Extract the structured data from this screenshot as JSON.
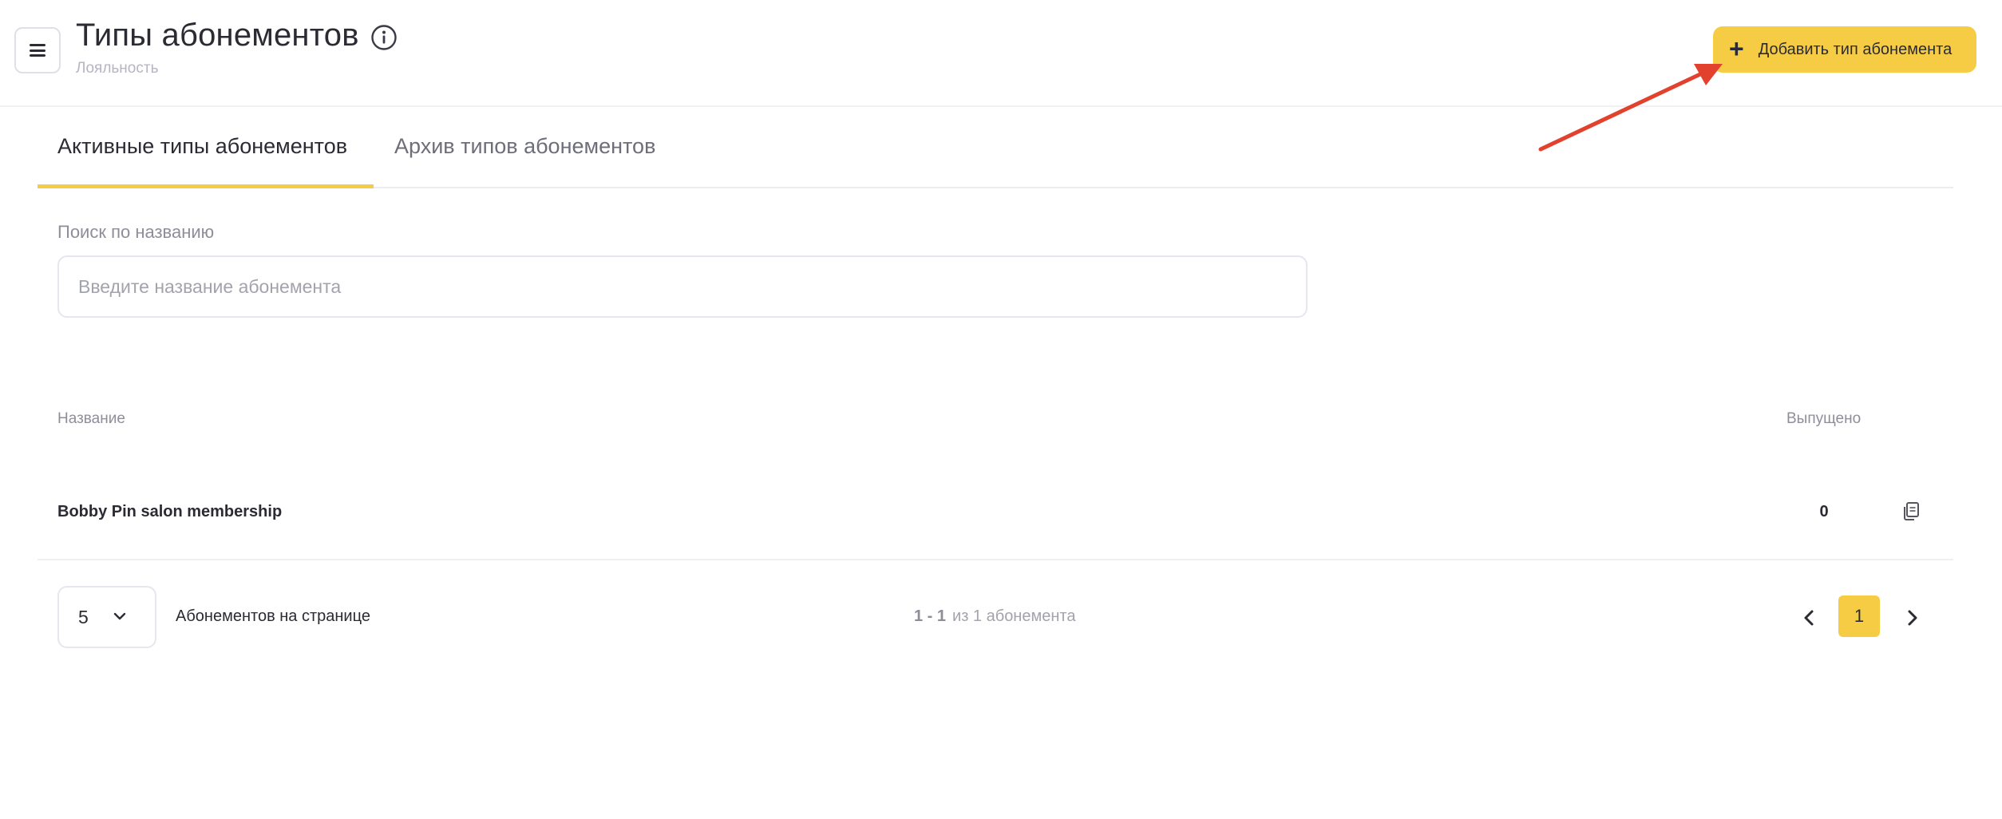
{
  "header": {
    "title": "Типы абонементов",
    "breadcrumb": "Лояльность",
    "add_button_label": "Добавить тип абонемента",
    "add_button_icon": "plus-icon",
    "menu_icon": "hamburger-menu-icon",
    "info_icon": "info-icon"
  },
  "tabs": [
    {
      "label": "Активные типы абонементов",
      "active": true
    },
    {
      "label": "Архив типов абонементов",
      "active": false
    }
  ],
  "search": {
    "label": "Поиск по названию",
    "placeholder": "Введите название абонемента",
    "value": ""
  },
  "table": {
    "columns": [
      "Название",
      "Выпущено"
    ],
    "rows": [
      {
        "name": "Bobby Pin salon membership",
        "issued": "0",
        "action_icon": "copy-icon"
      }
    ]
  },
  "pagination": {
    "page_size": "5",
    "page_size_label": "Абонементов на странице",
    "range": "1 - 1",
    "total_text": "из 1 абонемента",
    "current_page": "1",
    "prev_icon": "chevron-left-icon",
    "next_icon": "chevron-right-icon"
  },
  "colors": {
    "accent": "#f7cc45",
    "text": "#2b2b33",
    "muted": "#8e8e9a",
    "annotation_arrow": "#e2412e"
  }
}
